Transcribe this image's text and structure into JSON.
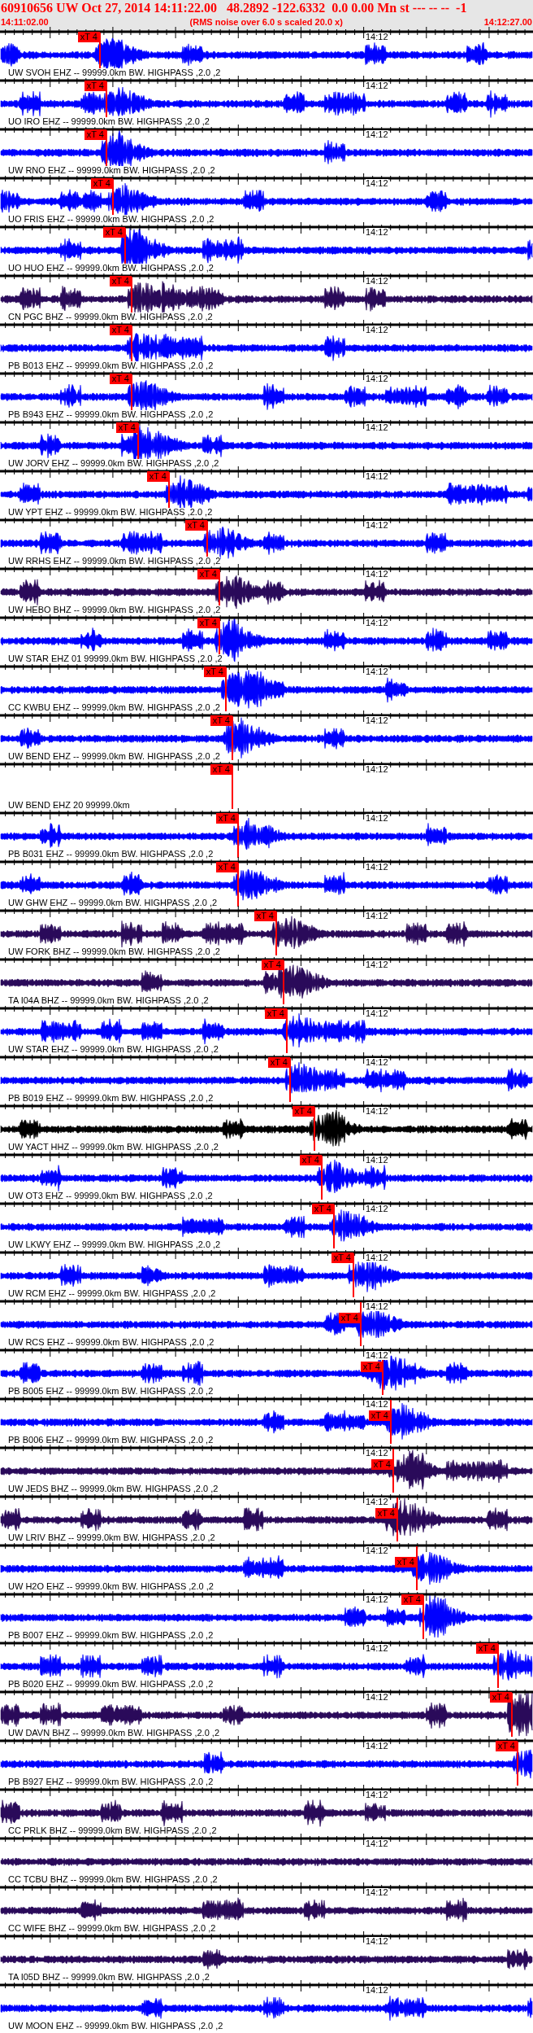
{
  "header": {
    "title": "60910656 UW Oct 27, 2014 14:11:22.00   48.2892 -122.6332  0.0 0.00 Mn st --- -- --  -1",
    "start_time": "14:11:02.00",
    "note": "(RMS noise over 6.0 s scaled 20.0 x)",
    "end_time": "14:12:27.00"
  },
  "traces": [
    {
      "label": "UW SVOH EHZ -- 99999.0km BW. HIGHPASS ,2.0 ,2",
      "tick_label": "14:12",
      "kind": "signal",
      "color": "#0000ff",
      "pick": {
        "label": "xT 4"
      }
    },
    {
      "label": "UO IRO EHZ -- 99999.0km BW. HIGHPASS ,2.0 ,2",
      "tick_label": "14:12",
      "kind": "signal",
      "color": "#0000ff",
      "pick": {
        "label": "xT 4"
      }
    },
    {
      "label": "UW RNO EHZ -- 99999.0km BW. HIGHPASS ,2.0 ,2",
      "tick_label": "14:12",
      "kind": "signal",
      "color": "#0000ff",
      "pick": {
        "label": "xT 4"
      }
    },
    {
      "label": "UO FRIS EHZ -- 99999.0km BW. HIGHPASS ,2.0 ,2",
      "tick_label": "14:12",
      "kind": "signal",
      "color": "#0000ff",
      "pick": {
        "label": "xT 4"
      }
    },
    {
      "label": "UO HUO EHZ -- 99999.0km BW. HIGHPASS ,2.0 ,2",
      "tick_label": "14:12",
      "kind": "signal",
      "color": "#0000ff",
      "pick": {
        "label": "xT 4"
      }
    },
    {
      "label": "CN PGC BHZ -- 99999.0km BW. HIGHPASS ,2.0 ,2",
      "tick_label": "14:12",
      "kind": "signal",
      "color": "#2a0a5a",
      "pick": {
        "label": "xT 4"
      }
    },
    {
      "label": "PB B013 EHZ -- 99999.0km BW. HIGHPASS ,2.0 ,2",
      "tick_label": "14:12",
      "kind": "signal",
      "color": "#0000ff",
      "pick": {
        "label": "xT 4"
      }
    },
    {
      "label": "PB B943 EHZ -- 99999.0km BW. HIGHPASS ,2.0 ,2",
      "tick_label": "14:12",
      "kind": "signal",
      "color": "#0000ff",
      "pick": {
        "label": "xT 4"
      }
    },
    {
      "label": "UW JORV EHZ -- 99999.0km BW. HIGHPASS ,2.0 ,2",
      "tick_label": "14:12",
      "kind": "signal",
      "color": "#0000ff",
      "pick": {
        "label": "xT 4"
      }
    },
    {
      "label": "UW YPT EHZ -- 99999.0km BW. HIGHPASS ,2.0 ,2",
      "tick_label": "14:12",
      "kind": "signal",
      "color": "#0000ff",
      "pick": {
        "label": "xT 4"
      }
    },
    {
      "label": "UW RRHS EHZ -- 99999.0km BW. HIGHPASS ,2.0 ,2",
      "tick_label": "14:12",
      "kind": "signal",
      "color": "#0000ff",
      "pick": {
        "label": "xT 4"
      }
    },
    {
      "label": "UW HEBO BHZ -- 99999.0km BW. HIGHPASS ,2.0 ,2",
      "tick_label": "14:12",
      "kind": "signal",
      "color": "#2a0a5a",
      "pick": {
        "label": "xT 4"
      }
    },
    {
      "label": "UW STAR EHZ 01 99999.0km BW. HIGHPASS ,2.0 ,2",
      "tick_label": "14:12",
      "kind": "signal",
      "color": "#0000ff",
      "pick": {
        "label": "xT 4"
      }
    },
    {
      "label": "CC KWBU EHZ -- 99999.0km BW. HIGHPASS ,2.0 ,2",
      "tick_label": "14:12",
      "kind": "signal",
      "color": "#0000ff",
      "pick": {
        "label": "xT 4"
      }
    },
    {
      "label": "UW BEND EHZ -- 99999.0km BW. HIGHPASS ,2.0 ,2",
      "tick_label": "14:12",
      "kind": "signal",
      "color": "#0000ff",
      "pick": {
        "label": "xT 4"
      }
    },
    {
      "label": "UW BEND EHZ 20 99999.0km",
      "tick_label": "14:12",
      "kind": "blank",
      "pick": {
        "label": "xT 4"
      }
    },
    {
      "label": "PB B031 EHZ -- 99999.0km BW. HIGHPASS ,2.0 ,2",
      "tick_label": "14:12",
      "kind": "signal",
      "color": "#0000ff",
      "pick": {
        "label": "xT 4"
      }
    },
    {
      "label": "UW GHW EHZ -- 99999.0km BW. HIGHPASS ,2.0 ,2",
      "tick_label": "14:12",
      "kind": "signal",
      "color": "#0000ff",
      "pick": {
        "label": "xT 4"
      }
    },
    {
      "label": "UW FORK BHZ -- 99999.0km BW. HIGHPASS ,2.0 ,2",
      "tick_label": "14:12",
      "kind": "signal",
      "color": "#2a0a5a",
      "pick": {
        "label": "xT 4"
      }
    },
    {
      "label": "TA I04A BHZ -- 99999.0km BW. HIGHPASS ,2.0 ,2",
      "tick_label": "14:12",
      "kind": "signal",
      "color": "#2a0a5a",
      "pick": {
        "label": "xT 4"
      }
    },
    {
      "label": "UW STAR EHZ -- 99999.0km BW. HIGHPASS ,2.0 ,2",
      "tick_label": "14:12",
      "kind": "signal",
      "color": "#0000ff",
      "pick": {
        "label": "xT 4"
      }
    },
    {
      "label": "PB B019 EHZ -- 99999.0km BW. HIGHPASS ,2.0 ,2",
      "tick_label": "14:12",
      "kind": "signal",
      "color": "#0000ff",
      "pick": {
        "label": "xT 4"
      }
    },
    {
      "label": "UW YACT HHZ -- 99999.0km BW. HIGHPASS ,2.0 ,2",
      "tick_label": "14:12",
      "kind": "signal",
      "color": "#000000",
      "pick": {
        "label": "xT 4"
      }
    },
    {
      "label": "UW OT3 EHZ -- 99999.0km BW. HIGHPASS ,2.0 ,2",
      "tick_label": "14:12",
      "kind": "signal",
      "color": "#0000ff",
      "pick": {
        "label": "xT 4"
      }
    },
    {
      "label": "UW LKWY EHZ -- 99999.0km BW. HIGHPASS ,2.0 ,2",
      "tick_label": "14:12",
      "kind": "signal",
      "color": "#0000ff",
      "pick": {
        "label": "xT 4"
      }
    },
    {
      "label": "UW RCM EHZ -- 99999.0km BW. HIGHPASS ,2.0 ,2",
      "tick_label": "14:12",
      "kind": "signal",
      "color": "#0000ff",
      "pick": {
        "label": "xT 4"
      }
    },
    {
      "label": "UW RCS EHZ -- 99999.0km BW. HIGHPASS ,2.0 ,2",
      "tick_label": "14:12",
      "kind": "signal",
      "color": "#0000ff",
      "pick": {
        "label": "xT 4"
      }
    },
    {
      "label": "PB B005 EHZ -- 99999.0km BW. HIGHPASS ,2.0 ,2",
      "tick_label": "14:12",
      "kind": "signal",
      "color": "#0000ff",
      "pick": {
        "label": "xT 4"
      }
    },
    {
      "label": "PB B006 EHZ -- 99999.0km BW. HIGHPASS ,2.0 ,2",
      "tick_label": "14:12",
      "kind": "signal",
      "color": "#0000ff",
      "pick": {
        "label": "xT 4"
      }
    },
    {
      "label": "UW JEDS BHZ -- 99999.0km BW. HIGHPASS ,2.0 ,2",
      "tick_label": "14:12",
      "kind": "signal",
      "color": "#2a0a5a",
      "pick": {
        "label": "xT 4"
      }
    },
    {
      "label": "UW LRIV BHZ -- 99999.0km BW. HIGHPASS ,2.0 ,2",
      "tick_label": "14:12",
      "kind": "signal",
      "color": "#2a0a5a",
      "pick": {
        "label": "xT 4"
      }
    },
    {
      "label": "UW H2O EHZ -- 99999.0km BW. HIGHPASS ,2.0 ,2",
      "tick_label": "14:12",
      "kind": "signal",
      "color": "#0000ff",
      "pick": {
        "label": "xT 4"
      }
    },
    {
      "label": "PB B007 EHZ -- 99999.0km BW. HIGHPASS ,2.0 ,2",
      "tick_label": "14:12",
      "kind": "signal",
      "color": "#0000ff",
      "pick": {
        "label": "xT 4"
      }
    },
    {
      "label": "PB B020 EHZ -- 99999.0km BW. HIGHPASS ,2.0 ,2",
      "tick_label": "14:12",
      "kind": "signal",
      "color": "#0000ff",
      "pick": {
        "label": "xT 4"
      }
    },
    {
      "label": "UW DAVN BHZ -- 99999.0km BW. HIGHPASS ,2.0 ,2",
      "tick_label": "14:12",
      "kind": "signal",
      "color": "#2a0a5a",
      "pick": {
        "label": "xT 4"
      }
    },
    {
      "label": "PB B927 EHZ -- 99999.0km BW. HIGHPASS ,2.0 ,2",
      "tick_label": "14:12",
      "kind": "signal",
      "color": "#0000ff",
      "pick": {
        "label": "xT 4"
      }
    },
    {
      "label": "CC PRLK BHZ -- 99999.0km BW. HIGHPASS ,2.0 ,2",
      "tick_label": "14:12",
      "kind": "signal",
      "color": "#2a0a5a"
    },
    {
      "label": "CC TCBU BHZ -- 99999.0km BW. HIGHPASS ,2.0 ,2",
      "tick_label": "14:12",
      "kind": "signal",
      "color": "#2a0a5a"
    },
    {
      "label": "CC WIFE BHZ -- 99999.0km BW. HIGHPASS ,2.0 ,2",
      "tick_label": "14:12",
      "kind": "signal",
      "color": "#2a0a5a"
    },
    {
      "label": "TA I05D BHZ -- 99999.0km BW. HIGHPASS ,2.0 ,2",
      "tick_label": "14:12",
      "kind": "signal",
      "color": "#2a0a5a"
    },
    {
      "label": "UW MOON EHZ -- 99999.0km BW. HIGHPASS ,2.0 ,2",
      "tick_label": "14:12",
      "kind": "signal",
      "color": "#0000ff"
    }
  ]
}
